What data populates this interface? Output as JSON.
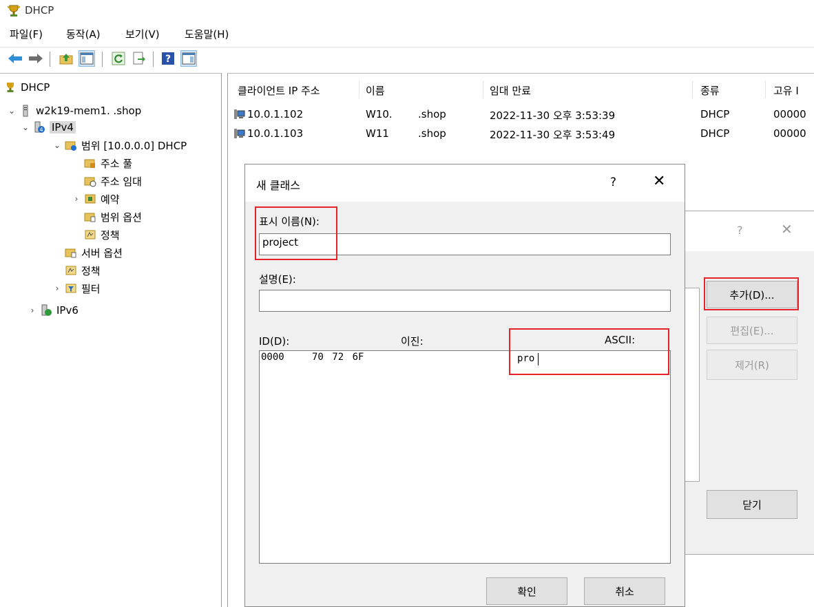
{
  "window": {
    "title": "DHCP"
  },
  "menu": {
    "items": [
      "파일(F)",
      "동작(A)",
      "보기(V)",
      "도움말(H)"
    ]
  },
  "toolbar": {
    "icons": [
      "back-arrow-icon",
      "forward-arrow-icon",
      "up-folder-icon",
      "show-hide-console-tree-icon",
      "refresh-icon",
      "export-list-icon",
      "help-icon",
      "show-action-pane-icon"
    ]
  },
  "tree": {
    "root": "DHCP",
    "server": "w2k19-mem1.        .shop",
    "ipv4": "IPv4",
    "scope": "범위 [10.0.0.0] DHCP",
    "address_pool": "주소 풀",
    "address_leases": "주소 임대",
    "reservations": "예약",
    "scope_options": "범위 옵션",
    "scope_policies": "정책",
    "server_options": "서버 옵션",
    "policies": "정책",
    "filters": "필터",
    "ipv6": "IPv6"
  },
  "leases": {
    "columns": [
      "클라이언트 IP 주소",
      "이름",
      "임대 만료",
      "종류",
      "고유 I"
    ],
    "rows": [
      {
        "ip": "10.0.1.102",
        "name": "W10.",
        "domain": ".shop",
        "expires": "2022-11-30 오후 3:53:39",
        "type": "DHCP",
        "uid": "00000"
      },
      {
        "ip": "10.0.1.103",
        "name": "W11",
        "domain": ".shop",
        "expires": "2022-11-30 오후 3:53:49",
        "type": "DHCP",
        "uid": "00000"
      }
    ]
  },
  "back_dialog": {
    "help": "?",
    "close": "✕",
    "add_label": "추가(D)...",
    "edit_label": "편집(E)...",
    "remove_label": "제거(R)",
    "close_label": "닫기"
  },
  "new_class_dialog": {
    "title": "새 클래스",
    "help": "?",
    "close": "✕",
    "display_name_label": "표시 이름(N):",
    "display_name_value": "project",
    "description_label": "설명(E):",
    "description_value": "",
    "id_label": "ID(D):",
    "binary_label": "이진:",
    "ascii_label": "ASCII:",
    "hex_offset": "0000",
    "hex_bytes": "70 72 6F",
    "ascii_value": "pro",
    "ok_label": "확인",
    "cancel_label": "취소"
  },
  "highlight_color": "#e8202a"
}
